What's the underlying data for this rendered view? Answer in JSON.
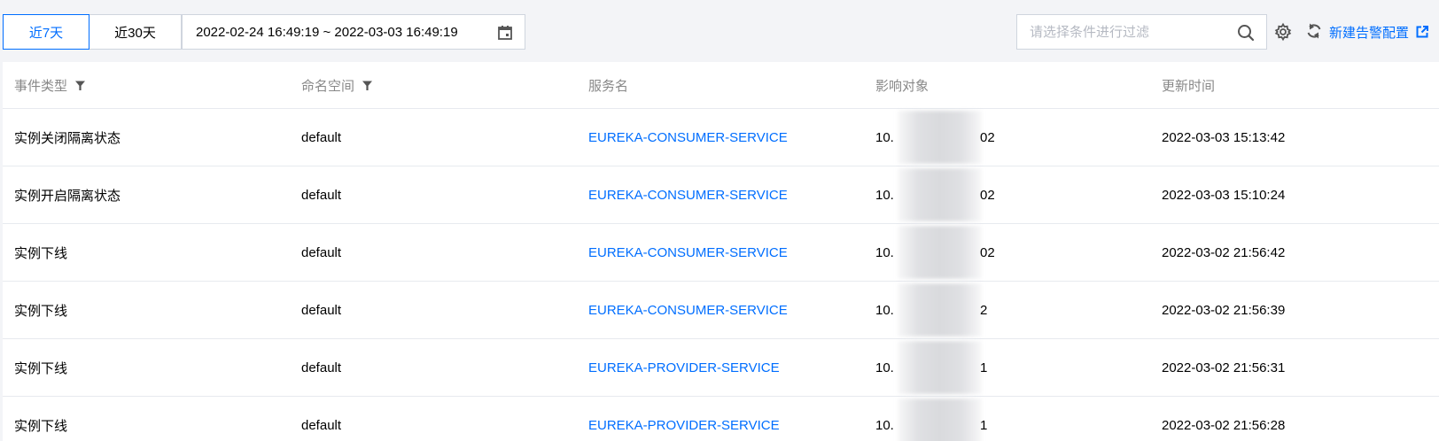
{
  "toolbar": {
    "range_7d": "近7天",
    "range_30d": "近30天",
    "date_range": "2022-02-24 16:49:19 ~ 2022-03-03 16:49:19",
    "search_placeholder": "请选择条件进行过滤",
    "new_alarm_config": "新建告警配置"
  },
  "table": {
    "headers": {
      "event_type": "事件类型",
      "namespace": "命名空间",
      "service_name": "服务名",
      "affected_object": "影响对象",
      "update_time": "更新时间"
    },
    "rows": [
      {
        "event_type": "实例关闭隔离状态",
        "namespace": "default",
        "service": "EUREKA-CONSUMER-SERVICE",
        "ip_prefix": "10.",
        "ip_suffix": "02",
        "time": "2022-03-03 15:13:42"
      },
      {
        "event_type": "实例开启隔离状态",
        "namespace": "default",
        "service": "EUREKA-CONSUMER-SERVICE",
        "ip_prefix": "10.",
        "ip_suffix": "02",
        "time": "2022-03-03 15:10:24"
      },
      {
        "event_type": "实例下线",
        "namespace": "default",
        "service": "EUREKA-CONSUMER-SERVICE",
        "ip_prefix": "10.",
        "ip_suffix": "02",
        "time": "2022-03-02 21:56:42"
      },
      {
        "event_type": "实例下线",
        "namespace": "default",
        "service": "EUREKA-CONSUMER-SERVICE",
        "ip_prefix": "10.",
        "ip_suffix": "2",
        "time": "2022-03-02 21:56:39"
      },
      {
        "event_type": "实例下线",
        "namespace": "default",
        "service": "EUREKA-PROVIDER-SERVICE",
        "ip_prefix": "10.",
        "ip_suffix": "1",
        "time": "2022-03-02 21:56:31"
      },
      {
        "event_type": "实例下线",
        "namespace": "default",
        "service": "EUREKA-PROVIDER-SERVICE",
        "ip_prefix": "10.",
        "ip_suffix": "1",
        "time": "2022-03-02 21:56:28"
      }
    ]
  },
  "colors": {
    "accent": "#006eff",
    "border": "#cfd5de",
    "header_text": "#888888",
    "background": "#f3f4f7"
  },
  "icons": [
    "calendar-icon",
    "search-icon",
    "gear-icon",
    "refresh-icon",
    "external-link-icon",
    "filter-icon"
  ]
}
